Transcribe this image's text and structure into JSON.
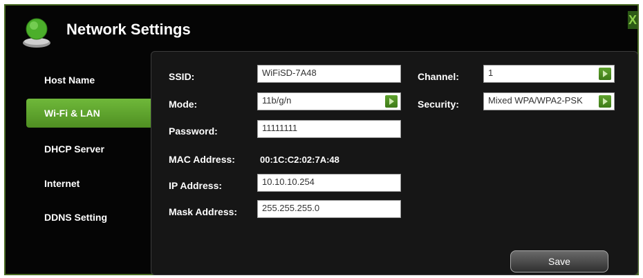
{
  "app": {
    "title": "Network Settings",
    "close_label": "X"
  },
  "sidebar": {
    "items": [
      {
        "label": "Host Name"
      },
      {
        "label": "Wi-Fi & LAN"
      },
      {
        "label": "DHCP Server"
      },
      {
        "label": "Internet"
      },
      {
        "label": "DDNS Setting"
      }
    ],
    "active_index": 1
  },
  "form": {
    "ssid": {
      "label": "SSID:",
      "value": "WiFiSD-7A48"
    },
    "mode": {
      "label": "Mode:",
      "value": "11b/g/n"
    },
    "password": {
      "label": "Password:",
      "value": "11111111"
    },
    "mac": {
      "label": "MAC Address:",
      "value": "00:1C:C2:02:7A:48"
    },
    "ip": {
      "label": "IP Address:",
      "value": "10.10.10.254"
    },
    "mask": {
      "label": "Mask Address:",
      "value": "255.255.255.0"
    },
    "channel": {
      "label": "Channel:",
      "value": "1"
    },
    "security": {
      "label": "Security:",
      "value": "Mixed WPA/WPA2-PSK"
    }
  },
  "actions": {
    "save_label": "Save"
  },
  "colors": {
    "accent": "#5fa22e",
    "background": "#050505"
  },
  "icons": {
    "logo": "network-globe-icon",
    "select_arrow": "play-arrow-icon"
  }
}
